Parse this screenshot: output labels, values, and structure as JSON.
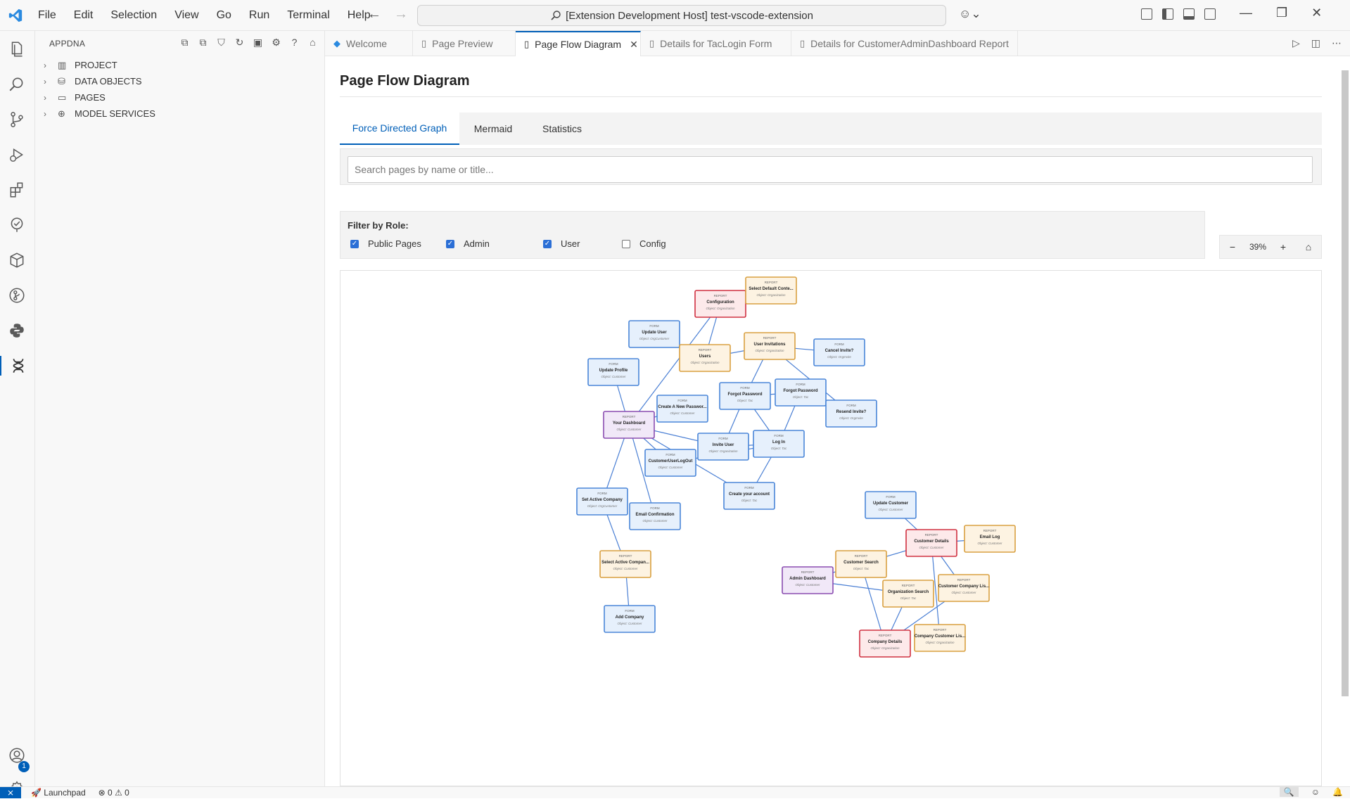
{
  "menu": [
    "File",
    "Edit",
    "Selection",
    "View",
    "Go",
    "Run",
    "Terminal",
    "Help"
  ],
  "command_center": "[Extension Development Host] test-vscode-extension",
  "sidebar": {
    "title": "APPDNA",
    "items": [
      {
        "label": "PROJECT",
        "icon": "project-board-icon"
      },
      {
        "label": "DATA OBJECTS",
        "icon": "database-icon"
      },
      {
        "label": "PAGES",
        "icon": "window-icon"
      },
      {
        "label": "MODEL SERVICES",
        "icon": "globe-icon"
      }
    ]
  },
  "tabs": [
    {
      "label": "Welcome",
      "icon": "vscode-logo-icon"
    },
    {
      "label": "Page Preview",
      "icon": "file-icon"
    },
    {
      "label": "Page Flow Diagram",
      "icon": "file-icon",
      "active": true
    },
    {
      "label": "Details for TacLogin Form",
      "icon": "file-icon"
    },
    {
      "label": "Details for CustomerAdminDashboard Report",
      "icon": "file-icon"
    }
  ],
  "main": {
    "title": "Page Flow Diagram",
    "view_tabs": [
      "Force Directed Graph",
      "Mermaid",
      "Statistics"
    ],
    "search_placeholder": "Search pages by name or title...",
    "filter": {
      "title": "Filter by Role:",
      "roles": [
        {
          "label": "Public Pages",
          "checked": true
        },
        {
          "label": "Admin",
          "checked": true
        },
        {
          "label": "User",
          "checked": true
        },
        {
          "label": "Config",
          "checked": false
        }
      ]
    },
    "zoom": {
      "minus": "−",
      "level": "39%",
      "plus": "+",
      "home": "⌂"
    }
  },
  "colors": {
    "accent": "#005fb8",
    "form": {
      "fill": "#e6f0fc",
      "stroke": "#4a86d8"
    },
    "report": {
      "fill": "#fdf3e2",
      "stroke": "#d9a040"
    },
    "config": {
      "fill": "#fde9ea",
      "stroke": "#d03040"
    },
    "dashboard": {
      "fill": "#f1e8f8",
      "stroke": "#8a4cb0"
    }
  },
  "graph": {
    "nodes": [
      {
        "id": "configuration",
        "type": "REPORT",
        "name": "Configuration",
        "owner": "Object: Organization",
        "kind": "config"
      },
      {
        "id": "select_default",
        "type": "REPORT",
        "name": "Select Default Conte...",
        "owner": "Object: Organization",
        "kind": "report"
      },
      {
        "id": "update_user",
        "type": "FORM",
        "name": "Update User",
        "owner": "Object: OrgCustomer",
        "kind": "form"
      },
      {
        "id": "users",
        "type": "REPORT",
        "name": "Users",
        "owner": "Object: Organization",
        "kind": "report"
      },
      {
        "id": "user_invitations",
        "type": "REPORT",
        "name": "User Invitations",
        "owner": "Object: Organization",
        "kind": "report"
      },
      {
        "id": "cancel_invite",
        "type": "FORM",
        "name": "Cancel Invite?",
        "owner": "Object: OrgInvite",
        "kind": "form"
      },
      {
        "id": "update_profile",
        "type": "FORM",
        "name": "Update Profile",
        "owner": "Object: Customer",
        "kind": "form"
      },
      {
        "id": "forgot_pw1",
        "type": "FORM",
        "name": "Forgot Password",
        "owner": "Object: Tac",
        "kind": "form"
      },
      {
        "id": "forgot_pw2",
        "type": "FORM",
        "name": "Forgot Password",
        "owner": "Object: Tac",
        "kind": "form"
      },
      {
        "id": "create_pw",
        "type": "FORM",
        "name": "Create A New Passwor...",
        "owner": "Object: Customer",
        "kind": "form"
      },
      {
        "id": "resend_invite",
        "type": "FORM",
        "name": "Resend Invite?",
        "owner": "Object: OrgInvite",
        "kind": "form"
      },
      {
        "id": "your_dashboard",
        "type": "REPORT",
        "name": "Your Dashboard",
        "owner": "Object: Customer",
        "kind": "dashboard"
      },
      {
        "id": "invite_user",
        "type": "FORM",
        "name": "Invite User",
        "owner": "Object: Organization",
        "kind": "form"
      },
      {
        "id": "log_in",
        "type": "FORM",
        "name": "Log In",
        "owner": "Object: Tac",
        "kind": "form"
      },
      {
        "id": "logout",
        "type": "FORM",
        "name": "CustomerUserLogOut",
        "owner": "Object: Customer",
        "kind": "form"
      },
      {
        "id": "create_account",
        "type": "FORM",
        "name": "Create your account",
        "owner": "Object: Tac",
        "kind": "form"
      },
      {
        "id": "set_active",
        "type": "FORM",
        "name": "Set Active Company",
        "owner": "Object: OrgCustomer",
        "kind": "form"
      },
      {
        "id": "email_conf",
        "type": "FORM",
        "name": "Email Confirmation",
        "owner": "Object: Customer",
        "kind": "form"
      },
      {
        "id": "update_customer",
        "type": "FORM",
        "name": "Update Customer",
        "owner": "Object: Customer",
        "kind": "form"
      },
      {
        "id": "customer_details",
        "type": "REPORT",
        "name": "Customer Details",
        "owner": "Object: Customer",
        "kind": "config"
      },
      {
        "id": "email_log",
        "type": "REPORT",
        "name": "Email Log",
        "owner": "Object: Customer",
        "kind": "report"
      },
      {
        "id": "select_active",
        "type": "REPORT",
        "name": "Select Active Compan...",
        "owner": "Object: Customer",
        "kind": "report"
      },
      {
        "id": "customer_search",
        "type": "REPORT",
        "name": "Customer Search",
        "owner": "Object: Tac",
        "kind": "report"
      },
      {
        "id": "admin_dashboard",
        "type": "REPORT",
        "name": "Admin Dashboard",
        "owner": "Object: Customer",
        "kind": "dashboard"
      },
      {
        "id": "org_search",
        "type": "REPORT",
        "name": "Organization Search",
        "owner": "Object: Tac",
        "kind": "report"
      },
      {
        "id": "cust_company_list",
        "type": "REPORT",
        "name": "Customer Company Lis...",
        "owner": "Object: Customer",
        "kind": "report"
      },
      {
        "id": "add_company",
        "type": "FORM",
        "name": "Add Company",
        "owner": "Object: Customer",
        "kind": "form"
      },
      {
        "id": "company_details",
        "type": "REPORT",
        "name": "Company Details",
        "owner": "Object: Organization",
        "kind": "config"
      },
      {
        "id": "company_customer_list",
        "type": "REPORT",
        "name": "Company Customer Lis...",
        "owner": "Object: Organization",
        "kind": "report"
      }
    ],
    "edges": [
      [
        "configuration",
        "select_default"
      ],
      [
        "configuration",
        "users"
      ],
      [
        "configuration",
        "your_dashboard"
      ],
      [
        "update_user",
        "users"
      ],
      [
        "users",
        "user_invitations"
      ],
      [
        "user_invitations",
        "cancel_invite"
      ],
      [
        "user_invitations",
        "forgot_pw1"
      ],
      [
        "user_invitations",
        "resend_invite"
      ],
      [
        "update_profile",
        "your_dashboard"
      ],
      [
        "forgot_pw1",
        "forgot_pw2"
      ],
      [
        "forgot_pw1",
        "invite_user"
      ],
      [
        "forgot_pw1",
        "log_in"
      ],
      [
        "forgot_pw2",
        "log_in"
      ],
      [
        "create_pw",
        "your_dashboard"
      ],
      [
        "your_dashboard",
        "invite_user"
      ],
      [
        "your_dashboard",
        "logout"
      ],
      [
        "your_dashboard",
        "set_active"
      ],
      [
        "your_dashboard",
        "email_conf"
      ],
      [
        "your_dashboard",
        "create_account"
      ],
      [
        "invite_user",
        "log_in"
      ],
      [
        "logout",
        "log_in"
      ],
      [
        "log_in",
        "create_account"
      ],
      [
        "set_active",
        "select_active"
      ],
      [
        "select_active",
        "add_company"
      ],
      [
        "update_customer",
        "customer_details"
      ],
      [
        "customer_details",
        "email_log"
      ],
      [
        "customer_details",
        "customer_search"
      ],
      [
        "customer_details",
        "cust_company_list"
      ],
      [
        "customer_details",
        "company_customer_list"
      ],
      [
        "customer_search",
        "admin_dashboard"
      ],
      [
        "customer_search",
        "company_details"
      ],
      [
        "admin_dashboard",
        "org_search"
      ],
      [
        "org_search",
        "company_details"
      ],
      [
        "company_details",
        "cust_company_list"
      ]
    ]
  },
  "statusbar": {
    "remote": "⨯",
    "launchpad": "Launchpad",
    "problems": "⊗ 0 ⚠ 0"
  }
}
